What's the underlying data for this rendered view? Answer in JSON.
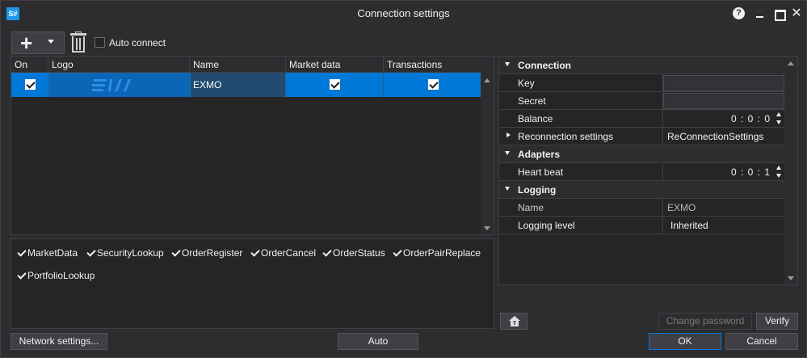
{
  "window": {
    "app_icon": "S#",
    "title": "Connection settings",
    "help_icon": "?",
    "close_icon": "✕"
  },
  "toolbar": {
    "add_icon": "+",
    "auto_connect_label": "Auto connect",
    "auto_connect_checked": false
  },
  "grid": {
    "columns": [
      "On",
      "Logo",
      "Name",
      "Market data",
      "Transactions"
    ],
    "rows": [
      {
        "on": true,
        "logo": "EXMO logo",
        "name": "EXMO",
        "market_data": true,
        "transactions": true
      }
    ]
  },
  "messages": [
    {
      "label": "MarketData",
      "checked": true
    },
    {
      "label": "SecurityLookup",
      "checked": true
    },
    {
      "label": "OrderRegister",
      "checked": true
    },
    {
      "label": "OrderCancel",
      "checked": true
    },
    {
      "label": "OrderStatus",
      "checked": true
    },
    {
      "label": "OrderPairReplace",
      "checked": true
    },
    {
      "label": "PortfolioLookup",
      "checked": true
    }
  ],
  "properties": {
    "connection": {
      "title": "Connection",
      "key_label": "Key",
      "key_value": "",
      "secret_label": "Secret",
      "secret_value": "",
      "balance_label": "Balance",
      "balance_value": "0 : 0 : 0",
      "reconnection_label": "Reconnection settings",
      "reconnection_value": "ReConnectionSettings"
    },
    "adapters": {
      "title": "Adapters",
      "heartbeat_label": "Heart beat",
      "heartbeat_value": "0 : 0 : 1"
    },
    "logging": {
      "title": "Logging",
      "name_label": "Name",
      "name_value": "EXMO",
      "level_label": "Logging level",
      "level_value": "Inherited"
    }
  },
  "buttons": {
    "change_password": "Change password",
    "verify": "Verify",
    "network_settings": "Network settings...",
    "auto": "Auto",
    "ok": "OK",
    "cancel": "Cancel"
  },
  "colors": {
    "accent": "#0078d7",
    "background": "#2d2d30",
    "panel": "#252526"
  }
}
